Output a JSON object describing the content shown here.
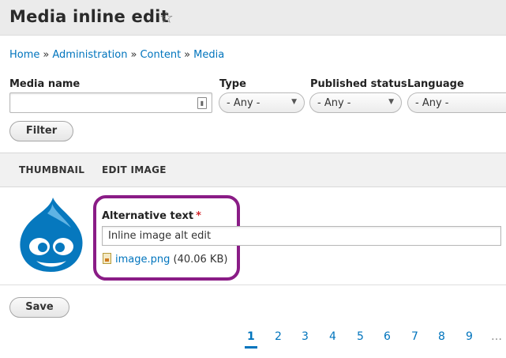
{
  "page": {
    "title": "Media inline edit"
  },
  "breadcrumb": [
    "Home",
    "Administration",
    "Content",
    "Media"
  ],
  "filters": {
    "media_name_label": "Media name",
    "media_name_value": "",
    "type_label": "Type",
    "type_value": "- Any -",
    "published_label": "Published status",
    "published_value": "- Any -",
    "language_label": "Language",
    "language_value": "- Any -",
    "filter_button": "Filter"
  },
  "table": {
    "columns": [
      "THUMBNAIL",
      "EDIT IMAGE"
    ],
    "row": {
      "alt_label": "Alternative text",
      "required_mark": "*",
      "alt_value": "Inline image alt edit",
      "file_name": "image.png",
      "file_size": "(40.06 KB)"
    }
  },
  "actions": {
    "save": "Save"
  },
  "pager": {
    "current": "1",
    "pages": [
      "2",
      "3",
      "4",
      "5",
      "6",
      "7",
      "8",
      "9"
    ],
    "ellipsis": "…"
  },
  "colors": {
    "link": "#0074bd",
    "highlight": "#8a1c86",
    "drupal_blue": "#0678be",
    "required": "#d4262c"
  },
  "icons": {
    "favorite": "star-icon",
    "thumbnail": "drupal-drop-logo",
    "file": "image-file-icon"
  }
}
